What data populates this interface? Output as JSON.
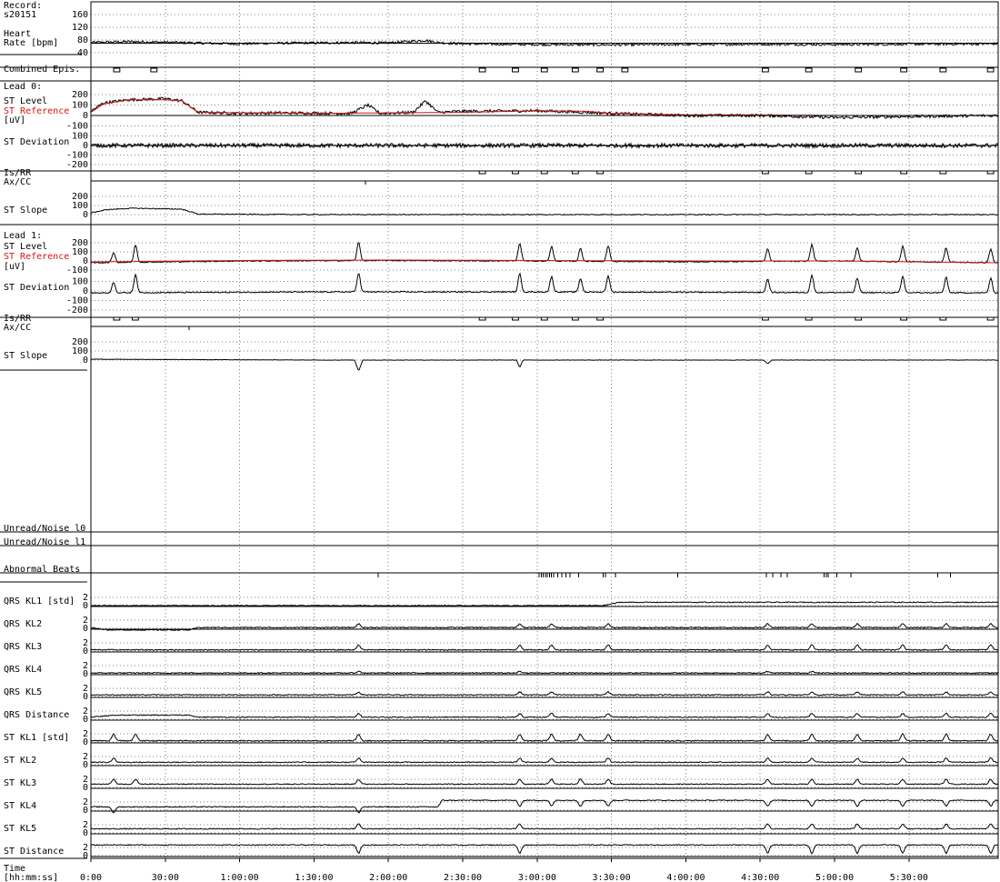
{
  "record": {
    "label": "Record:",
    "id": "s20151"
  },
  "chart_data": {
    "type": "line",
    "x_axis": {
      "label_line1": "Time",
      "label_line2": "[hh:mm:ss]",
      "range_seconds": [
        0,
        21960
      ],
      "ticks": [
        "0:00",
        "30:00",
        "1:00:00",
        "1:30:00",
        "2:00:00",
        "2:30:00",
        "3:00:00",
        "3:30:00",
        "4:00:00",
        "4:30:00",
        "5:00:00",
        "5:30:00"
      ],
      "tick_seconds": [
        0,
        1800,
        3600,
        5400,
        7200,
        9000,
        10800,
        12600,
        14400,
        16200,
        18000,
        19800
      ]
    },
    "colors": {
      "trace": "#000000",
      "reference": "#d11111",
      "grid": "#808080"
    },
    "heart_rate": {
      "label_line1": "Heart",
      "label_line2": "Rate [bpm]",
      "ticks": [
        160,
        120,
        80,
        40
      ],
      "ylim": [
        30,
        170
      ],
      "baseline": 70,
      "points": [
        [
          0,
          72
        ],
        [
          900,
          75
        ],
        [
          1800,
          73
        ],
        [
          2700,
          70
        ],
        [
          3600,
          68
        ],
        [
          4500,
          70
        ],
        [
          5400,
          71
        ],
        [
          6300,
          72
        ],
        [
          7200,
          71
        ],
        [
          8100,
          79
        ],
        [
          8400,
          72
        ],
        [
          9000,
          68
        ],
        [
          10800,
          66
        ],
        [
          12600,
          65
        ],
        [
          14400,
          66
        ],
        [
          16200,
          67
        ],
        [
          18000,
          66
        ],
        [
          19800,
          67
        ],
        [
          21960,
          68
        ]
      ]
    },
    "combined_episodes": {
      "label": "Combined Epis.",
      "intervals": [
        [
          550,
          700
        ],
        [
          1450,
          1600
        ],
        [
          9400,
          9550
        ],
        [
          10200,
          10350
        ],
        [
          10900,
          11050
        ],
        [
          11650,
          11800
        ],
        [
          12250,
          12400
        ],
        [
          12850,
          13000
        ],
        [
          16250,
          16400
        ],
        [
          17300,
          17450
        ],
        [
          18500,
          18650
        ],
        [
          19600,
          19750
        ],
        [
          20550,
          20700
        ],
        [
          21700,
          21850
        ]
      ]
    },
    "lead0": {
      "title": "Lead 0:",
      "st_level_label": "ST Level",
      "st_reference_label": "ST Reference",
      "unit_label": "[uV]",
      "st_deviation_label": "ST Deviation",
      "isrr_label": "Is/RR",
      "axcc_label": "Ax/CC",
      "st_slope_label": "ST Slope",
      "st_level_ticks": [
        200,
        100,
        0,
        -100
      ],
      "st_deviation_ticks": [
        100,
        0,
        -100,
        -200
      ],
      "st_slope_ticks": [
        200,
        100,
        0
      ],
      "st_level": [
        [
          0,
          40
        ],
        [
          300,
          120
        ],
        [
          900,
          150
        ],
        [
          1800,
          160
        ],
        [
          2200,
          140
        ],
        [
          2600,
          30
        ],
        [
          3600,
          20
        ],
        [
          4500,
          25
        ],
        [
          6300,
          20
        ],
        [
          6700,
          100
        ],
        [
          7000,
          20
        ],
        [
          7800,
          30
        ],
        [
          8100,
          140
        ],
        [
          8400,
          30
        ],
        [
          9000,
          40
        ],
        [
          10800,
          45
        ],
        [
          12000,
          30
        ],
        [
          12600,
          20
        ],
        [
          14400,
          0
        ],
        [
          16200,
          0
        ],
        [
          18000,
          -20
        ],
        [
          19800,
          -10
        ],
        [
          21960,
          0
        ]
      ],
      "st_reference": [
        [
          0,
          30
        ],
        [
          300,
          110
        ],
        [
          900,
          150
        ],
        [
          1800,
          150
        ],
        [
          2200,
          140
        ],
        [
          2600,
          30
        ],
        [
          5400,
          20
        ],
        [
          7200,
          25
        ],
        [
          9000,
          30
        ],
        [
          10800,
          45
        ],
        [
          12000,
          40
        ],
        [
          12600,
          20
        ],
        [
          14400,
          5
        ],
        [
          16200,
          5
        ],
        [
          18000,
          0
        ],
        [
          21960,
          0
        ]
      ],
      "st_deviation": [
        [
          0,
          0
        ],
        [
          5400,
          0
        ],
        [
          10800,
          0
        ],
        [
          16200,
          0
        ],
        [
          21960,
          0
        ]
      ],
      "isrr_intervals": [
        [
          9400,
          9550
        ],
        [
          10200,
          10350
        ],
        [
          10900,
          11050
        ],
        [
          11650,
          11800
        ],
        [
          12250,
          12400
        ],
        [
          16250,
          16400
        ],
        [
          17300,
          17450
        ],
        [
          18500,
          18650
        ],
        [
          19600,
          19750
        ],
        [
          20550,
          20700
        ],
        [
          21700,
          21850
        ]
      ],
      "axcc_marks": [
        6650
      ],
      "st_slope": [
        [
          0,
          20
        ],
        [
          400,
          55
        ],
        [
          1000,
          70
        ],
        [
          2200,
          60
        ],
        [
          2600,
          5
        ],
        [
          5400,
          0
        ],
        [
          9000,
          0
        ],
        [
          14400,
          0
        ],
        [
          21960,
          0
        ]
      ]
    },
    "lead1": {
      "title": "Lead 1:",
      "st_level_label": "ST Level",
      "st_reference_label": "ST Reference",
      "unit_label": "[uV]",
      "st_deviation_label": "ST Deviation",
      "isrr_label": "Is/RR",
      "axcc_label": "Ax/CC",
      "st_slope_label": "ST Slope",
      "st_level_ticks": [
        200,
        100,
        0,
        -100
      ],
      "st_deviation_ticks": [
        100,
        0,
        -100,
        -200
      ],
      "st_slope_ticks": [
        200,
        100,
        0
      ],
      "st_level_baseline": [
        [
          0,
          -20
        ],
        [
          3600,
          0
        ],
        [
          7200,
          5
        ],
        [
          10800,
          0
        ],
        [
          14400,
          -10
        ],
        [
          18000,
          0
        ],
        [
          21960,
          -20
        ]
      ],
      "st_reference": [
        [
          0,
          -10
        ],
        [
          3600,
          5
        ],
        [
          7200,
          10
        ],
        [
          10800,
          5
        ],
        [
          14400,
          0
        ],
        [
          18000,
          0
        ],
        [
          21960,
          -20
        ]
      ],
      "st_deviation_baseline": [
        [
          0,
          -20
        ],
        [
          5400,
          -10
        ],
        [
          10800,
          -10
        ],
        [
          16200,
          -15
        ],
        [
          21960,
          -20
        ]
      ],
      "episode_peaks": [
        [
          550,
          110
        ],
        [
          1080,
          190
        ],
        [
          6480,
          200
        ],
        [
          10380,
          190
        ],
        [
          11150,
          160
        ],
        [
          11850,
          140
        ],
        [
          12520,
          170
        ],
        [
          16380,
          140
        ],
        [
          17450,
          180
        ],
        [
          18550,
          150
        ],
        [
          19650,
          170
        ],
        [
          20700,
          160
        ],
        [
          21780,
          150
        ]
      ],
      "isrr_intervals": [
        [
          550,
          700
        ],
        [
          1000,
          1150
        ],
        [
          9400,
          9550
        ],
        [
          10200,
          10350
        ],
        [
          10900,
          11050
        ],
        [
          11650,
          11800
        ],
        [
          12250,
          12400
        ],
        [
          16250,
          16400
        ],
        [
          17300,
          17450
        ],
        [
          18500,
          18650
        ],
        [
          19600,
          19750
        ],
        [
          20550,
          20700
        ],
        [
          21700,
          21850
        ]
      ],
      "axcc_marks": [
        2380
      ],
      "st_slope": [
        [
          0,
          10
        ],
        [
          5400,
          0
        ],
        [
          6380,
          0
        ],
        [
          6480,
          -120
        ],
        [
          6580,
          0
        ],
        [
          10300,
          0
        ],
        [
          10380,
          -80
        ],
        [
          10460,
          0
        ],
        [
          16280,
          0
        ],
        [
          16380,
          -40
        ],
        [
          16480,
          0
        ],
        [
          21960,
          0
        ]
      ]
    },
    "unread_noise_0": {
      "label": "Unread/Noise l0"
    },
    "unread_noise_1": {
      "label": "Unread/Noise l1"
    },
    "abnormal_beats": {
      "label": "Abnormal Beats",
      "marks": [
        6950,
        10850,
        10900,
        10950,
        11000,
        11050,
        11100,
        11150,
        11200,
        11300,
        11400,
        11500,
        11600,
        11800,
        12400,
        12450,
        12700,
        14200,
        16350,
        16500,
        16700,
        16850,
        17750,
        17800,
        17850,
        18050,
        18400,
        20500,
        20800
      ]
    },
    "kl_tracks": {
      "ticks": [
        2,
        0
      ],
      "ylim": [
        -0.5,
        3
      ],
      "labels": [
        "QRS KL1 [std]",
        "QRS KL2",
        "QRS KL3",
        "QRS KL4",
        "QRS KL5",
        "QRS Distance",
        "ST KL1 [std]",
        "ST KL2",
        "ST KL3",
        "ST KL4",
        "ST KL5",
        "ST Distance"
      ],
      "series": [
        {
          "baseline": [
            [
              0,
              0
            ],
            [
              12400,
              0
            ],
            [
              12800,
              0.8
            ],
            [
              21960,
              0.8
            ]
          ],
          "bump_times": [],
          "bump_height": 0
        },
        {
          "baseline": [
            [
              0,
              0.2
            ],
            [
              400,
              -0.4
            ],
            [
              2400,
              -0.4
            ],
            [
              2600,
              0.2
            ],
            [
              21960,
              0.2
            ]
          ],
          "bump_times": [
            6480,
            10380,
            11150,
            12520,
            16380,
            17450,
            18550,
            19650,
            20700,
            21780
          ],
          "bump_height": 0.9
        },
        {
          "baseline": [
            [
              0,
              0.3
            ],
            [
              21960,
              0.3
            ]
          ],
          "bump_times": [
            6480,
            10380,
            11150,
            12520,
            16380,
            17450,
            18550,
            19650,
            20700,
            21780
          ],
          "bump_height": 1.2
        },
        {
          "baseline": [
            [
              0,
              0.2
            ],
            [
              21960,
              0.2
            ]
          ],
          "bump_times": [
            6480,
            10380,
            16380,
            17450
          ],
          "bump_height": 0.4
        },
        {
          "baseline": [
            [
              0,
              0.4
            ],
            [
              21960,
              0.4
            ]
          ],
          "bump_times": [
            6480,
            10380,
            11150,
            12520,
            16380,
            17450,
            18550,
            19650,
            20700,
            21780
          ],
          "bump_height": 0.7
        },
        {
          "baseline": [
            [
              0,
              0.5
            ],
            [
              600,
              1.0
            ],
            [
              2400,
              1.0
            ],
            [
              2600,
              0.5
            ],
            [
              21960,
              0.5
            ]
          ],
          "bump_times": [
            6480,
            10380,
            11150,
            12520,
            16380,
            17450,
            18550,
            19650,
            20700,
            21780
          ],
          "bump_height": 0.9
        },
        {
          "baseline": [
            [
              0,
              0.3
            ],
            [
              21960,
              0.3
            ]
          ],
          "bump_times": [
            550,
            1080,
            6480,
            10380,
            11150,
            11850,
            12520,
            16380,
            17450,
            18550,
            19650,
            20700,
            21780
          ],
          "bump_height": 1.6
        },
        {
          "baseline": [
            [
              0,
              0.6
            ],
            [
              21960,
              0.6
            ]
          ],
          "bump_times": [
            550,
            6480,
            10380,
            11150,
            12520,
            16380,
            17450,
            18550,
            19650,
            20700,
            21780
          ],
          "bump_height": 1.0
        },
        {
          "baseline": [
            [
              0,
              0.8
            ],
            [
              21960,
              0.8
            ]
          ],
          "bump_times": [
            550,
            1080,
            6480,
            10380,
            11150,
            11850,
            12520,
            16380,
            17450,
            18550,
            19650,
            20700,
            21780
          ],
          "bump_height": 1.2
        },
        {
          "baseline": [
            [
              0,
              0.8
            ],
            [
              8400,
              0.8
            ],
            [
              8500,
              2.4
            ],
            [
              21960,
              2.4
            ]
          ],
          "bump_times": [
            550,
            6480,
            10380,
            11150,
            11850,
            12520,
            16380,
            17450,
            18550,
            19650,
            20700,
            21780
          ],
          "bump_height": -1.4
        },
        {
          "baseline": [
            [
              0,
              1.0
            ],
            [
              21960,
              1.0
            ]
          ],
          "bump_times": [
            6480,
            10380,
            16380,
            17450,
            18550,
            19650,
            20700,
            21780
          ],
          "bump_height": 1.2
        },
        {
          "baseline": [
            [
              0,
              2.6
            ],
            [
              21960,
              2.6
            ]
          ],
          "bump_times": [
            6480,
            10380,
            16380,
            17450,
            18550,
            19650,
            20700,
            21780
          ],
          "bump_height": -2.0
        }
      ]
    }
  }
}
